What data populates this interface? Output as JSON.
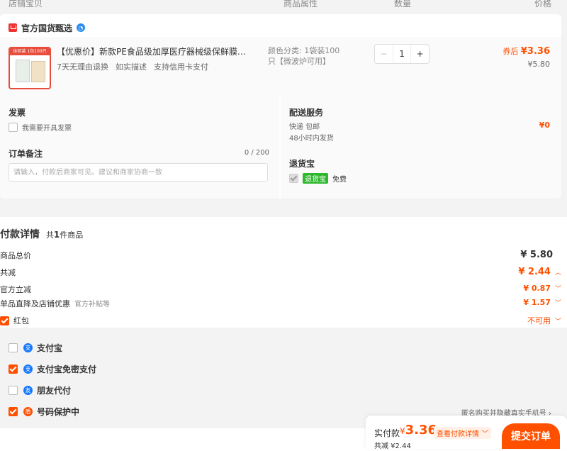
{
  "header": {
    "col_store_item": "店铺宝贝",
    "col_attr": "商品属性",
    "col_qty": "数量",
    "col_price": "价格"
  },
  "store": {
    "name": "官方国货甄选"
  },
  "product": {
    "thumb_ribbon": "体验装 1包100只",
    "title": "【优惠价】新款PE食品级加厚医疗器械级保鲜膜袋耐...",
    "tags": [
      "7天无理由退换",
      "如实描述",
      "支持信用卡支付"
    ],
    "attr": "颜色分类: 1袋装100只【微波炉可用】",
    "qty": "1",
    "minus": "−",
    "plus": "+",
    "price_after_label": "券后",
    "price_after": "¥3.36",
    "price_orig": "¥5.80"
  },
  "invoice": {
    "title": "发票",
    "checkbox_label": "我需要开具发票"
  },
  "memo": {
    "title": "订单备注",
    "counter": "0 / 200",
    "placeholder": "请输入，付款后商家可见。建议和商家协商一致"
  },
  "delivery": {
    "title": "配送服务",
    "method": "快递 包邮",
    "eta": "48小时内发货",
    "price": "¥0"
  },
  "return_service": {
    "title": "退货宝",
    "badge": "退货宝",
    "text": "免费"
  },
  "payment": {
    "title": "付款详情",
    "count_prefix": "共",
    "count": "1",
    "count_suffix": "件商品",
    "rows": [
      {
        "label": "商品总价",
        "value": "¥ 5.80"
      },
      {
        "label": "共减",
        "value": "¥ 2.44"
      },
      {
        "label": "官方立减",
        "value": "¥ 0.87"
      },
      {
        "label": "单品直降及店铺优惠",
        "sub": "官方补贴等",
        "value": "¥ 1.57"
      },
      {
        "label": "红包",
        "value": "不可用"
      }
    ],
    "methods": [
      {
        "label": "支付宝",
        "checked": false
      },
      {
        "label": "支付宝免密支付",
        "checked": true
      },
      {
        "label": "朋友代付",
        "checked": false
      },
      {
        "label": "号码保护中",
        "checked": true
      }
    ],
    "privacy_note": "匿名购买并隐藏真实手机号"
  },
  "footer": {
    "pay_label": "实付款",
    "pay_currency": "¥",
    "pay_amount": "3.36",
    "detail_link": "查看付款详情",
    "saved": "共减 ¥2.44",
    "submit": "提交订单"
  },
  "colors": {
    "accent": "#ff5000",
    "link_blue": "#1677ff",
    "return_green": "#2eb82e"
  }
}
